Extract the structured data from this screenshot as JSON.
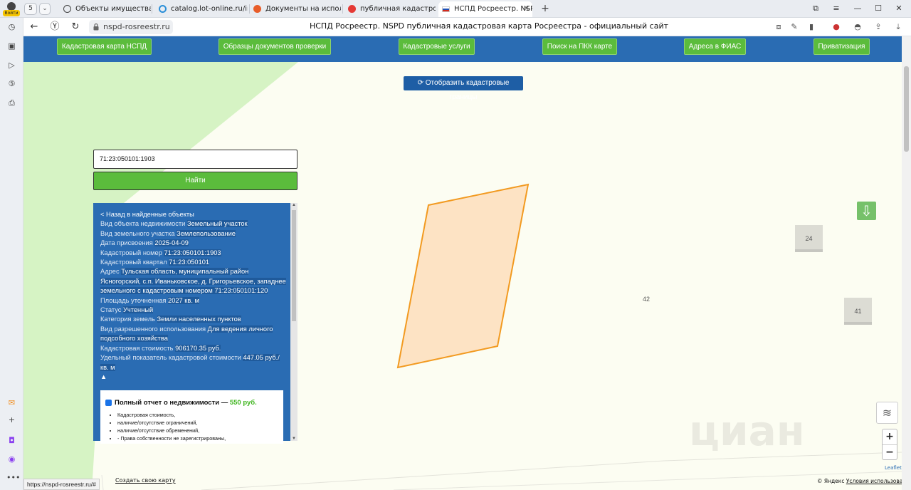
{
  "browser": {
    "profile_label": "Войти",
    "tab_count": "5",
    "tabs": [
      {
        "label": "Объекты имущества - ф",
        "color": "#444"
      },
      {
        "label": "catalog.lot-online.ru/inde",
        "color": "#2b8fd8"
      },
      {
        "label": "Документы на исполнен",
        "color": "#e85d2a"
      },
      {
        "label": "публичная кадастровая",
        "color": "#e53935"
      },
      {
        "label": "НСПД Росреестр. NSP",
        "color": "#d52b1e"
      }
    ],
    "url": "nspd-rosreestr.ru",
    "title": "НСПД Росреестр. NSPD публичная кадастровая карта Росреестра - официальный сайт",
    "status_url": "https://nspd-rosreestr.ru/#"
  },
  "nav": {
    "items": [
      "Кадастровая карта НСПД",
      "Образцы документов проверки",
      "Кадастровые услуги",
      "Поиск на ПКК карте",
      "Адреса в ФИАС",
      "Приватизация"
    ]
  },
  "map": {
    "show_borders_label": "Отобразить кадастровые границы",
    "search_value": "71:23:050101:1903",
    "find_label": "Найти",
    "tile_24": "24",
    "tile_41": "41",
    "label_42": "42",
    "leaflet": "Leaflet",
    "copyright_prefix": "© Яндекс",
    "copyright_link": "Условия использования",
    "create_map": "Создать свою карту",
    "watermark": "циан"
  },
  "info": {
    "back": "< Назад в найденные объекты",
    "rows": [
      {
        "label": "Вид объекта недвижимости",
        "value": "Земельный участок"
      },
      {
        "label": "Вид земельного участка",
        "value": "Землепользование"
      },
      {
        "label": "Дата присвоения",
        "value": "2025-04-09"
      },
      {
        "label": "Кадастровый номер",
        "value": "71:23:050101:1903"
      },
      {
        "label": "Кадастровый квартал",
        "value": "71:23:050101"
      },
      {
        "label": "Адрес",
        "value": "Тульская область, муниципальный район Ясногорский, с.п. Иваньковское, д. Григорьевское, западнее земельного с кадастровым номером 71:23:050101:120"
      },
      {
        "label": "Площадь уточненная",
        "value": "2027 кв. м"
      },
      {
        "label": "Статус",
        "value": "Учтенный"
      },
      {
        "label": "Категория земель",
        "value": "Земли населенных пунктов"
      },
      {
        "label": "Вид разрешенного использования",
        "value": "Для ведения личного подсобного хозяйства"
      },
      {
        "label": "Кадастровая стоимость",
        "value": "906170.35 руб."
      },
      {
        "label": "Удельный показатель кадастровой стоимости",
        "value": "447.05 руб./кв. м"
      }
    ],
    "collapse": "▲",
    "report_title": "Полный отчет о недвижимости —",
    "report_price": "550 руб.",
    "report_items": [
      "Кадастровая стоимость,",
      "наличие/отсутствие ограничений,",
      "наличие/отсутствие обременений,",
      "- Права собственности не зарегистрированы,"
    ]
  },
  "colors": {
    "nav_bg": "#2a6cb3",
    "nav_button": "#5bbc3c",
    "parcel_fill": "#fde3c4",
    "parcel_stroke": "#f29a20"
  }
}
